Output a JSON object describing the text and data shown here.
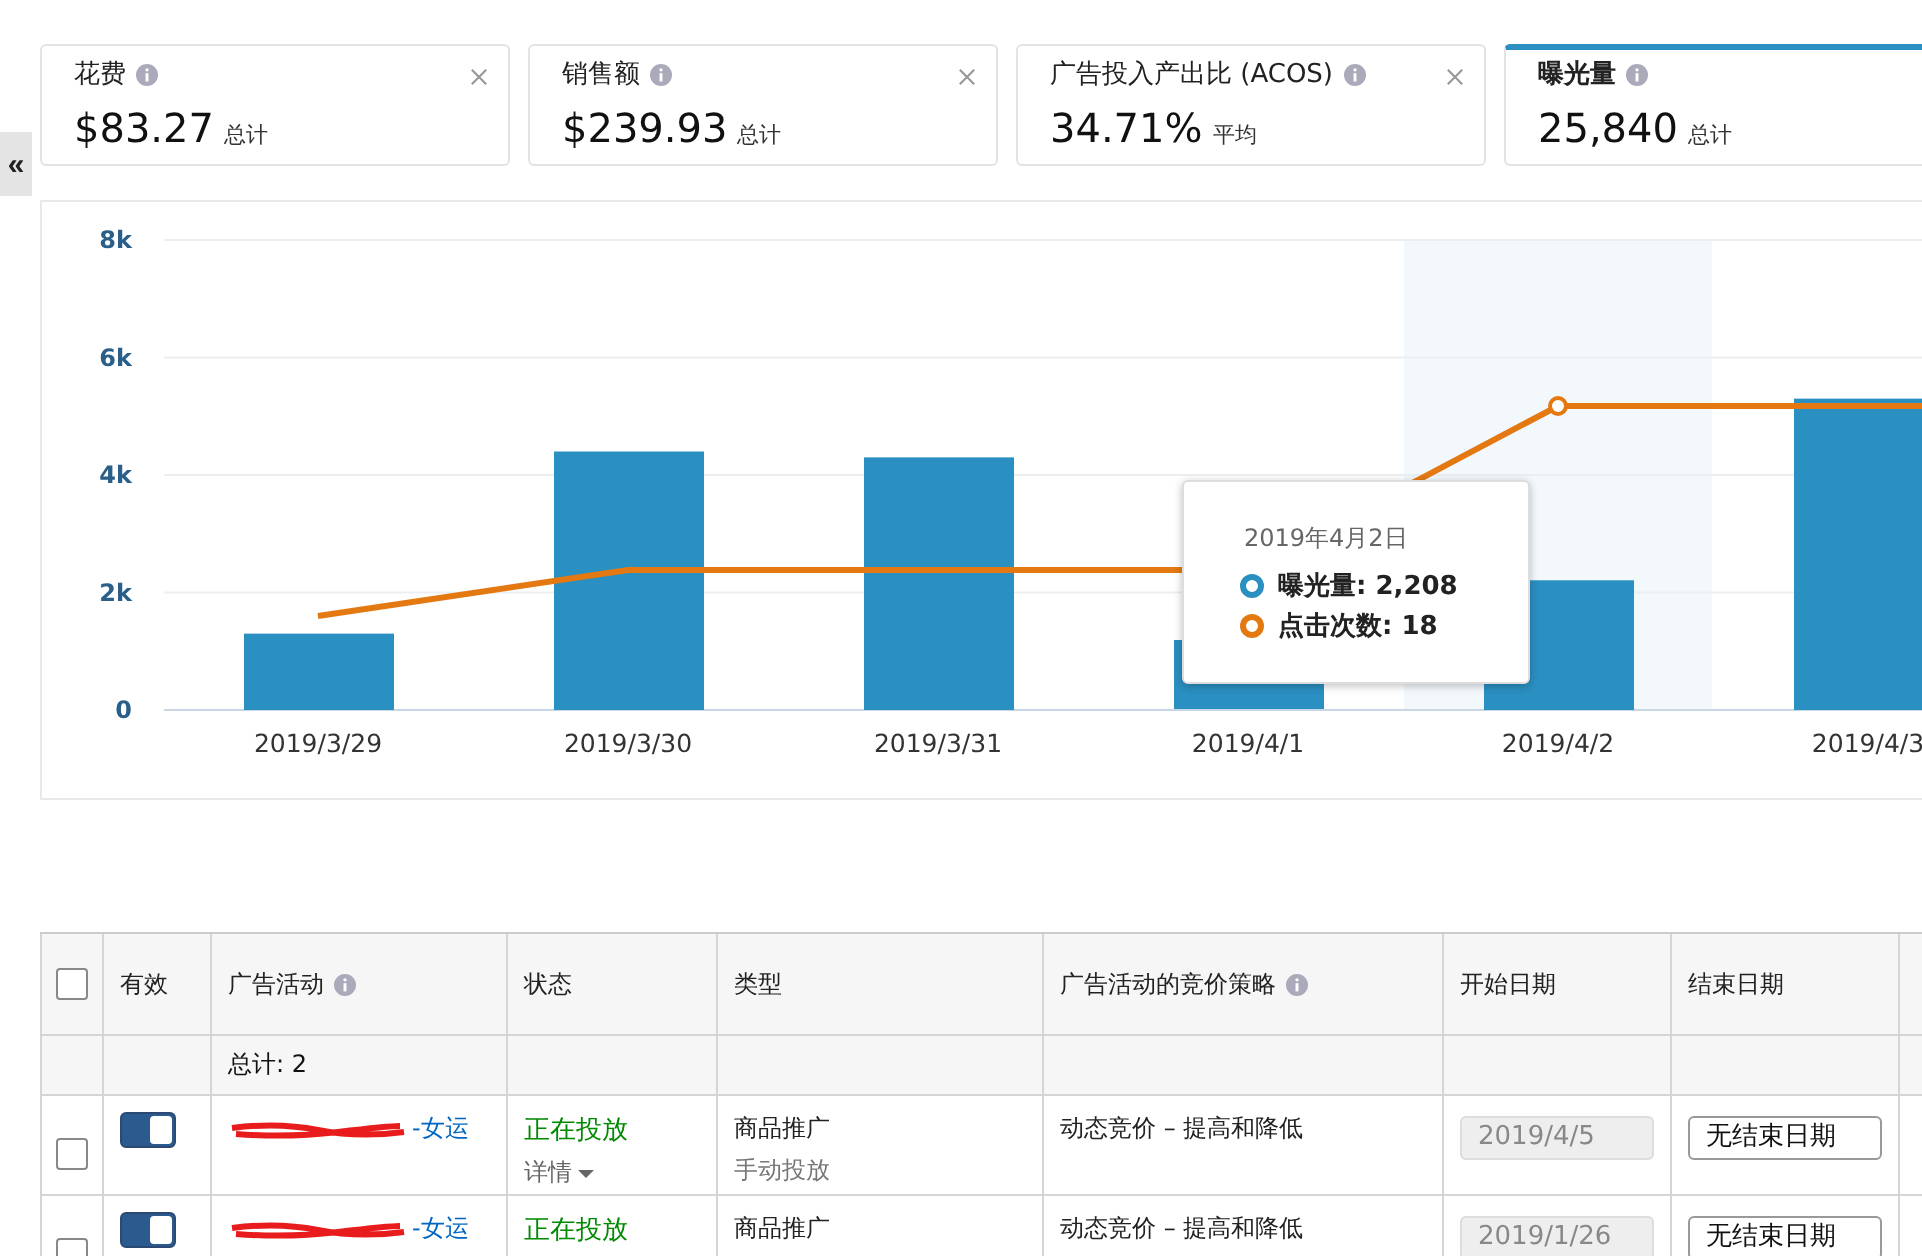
{
  "metric_cards": [
    {
      "label": "花费",
      "value": "$83.27",
      "unit": "总计",
      "selected": false,
      "closable": true
    },
    {
      "label": "销售额",
      "value": "$239.93",
      "unit": "总计",
      "selected": false,
      "closable": true
    },
    {
      "label": "广告投入产出比 (ACOS)",
      "value": "34.71%",
      "unit": "平均",
      "selected": false,
      "closable": true
    },
    {
      "label": "曝光量",
      "value": "25,840",
      "unit": "总计",
      "selected": true,
      "closable": false
    }
  ],
  "sidebar_toggle": "«",
  "chart": {
    "chart_data": {
      "type": "bar",
      "categories": [
        "2019/3/29",
        "2019/3/30",
        "2019/3/31",
        "2019/4/1",
        "2019/4/2",
        "2019/4/3"
      ],
      "values": [
        1300,
        4400,
        4300,
        null,
        2208,
        5300
      ],
      "ylim": [
        0,
        8000
      ],
      "grid": true,
      "yticks": [
        {
          "value": 0,
          "label": "0"
        },
        {
          "value": 2000,
          "label": "2k"
        },
        {
          "value": 4000,
          "label": "4k"
        },
        {
          "value": 6000,
          "label": "6k"
        },
        {
          "value": 8000,
          "label": "8k"
        }
      ]
    },
    "tooltip": {
      "date": "2019年4月2日",
      "lines": [
        {
          "label": "曝光量:",
          "value": "2,208",
          "color": "#2a8fc1"
        },
        {
          "label": "点击次数:",
          "value": "18",
          "color": "#e47911"
        }
      ]
    }
  },
  "table": {
    "select_all_checked": false,
    "columns": [
      "有效",
      "广告活动",
      "状态",
      "类型",
      "广告活动的竞价策略",
      "开始日期",
      "结束日期"
    ],
    "column_info": [
      false,
      true,
      false,
      false,
      true,
      false,
      false
    ],
    "total": "总计: 2",
    "rows": [
      {
        "checked": false,
        "enabled": true,
        "campaign": "-女运",
        "status": "正在投放",
        "details": "详情",
        "type": "商品推广",
        "targeting": "手动投放",
        "bidding": "动态竞价 – 提高和降低",
        "start_date": "2019/4/5",
        "end_date": "无结束日期"
      },
      {
        "checked": false,
        "enabled": true,
        "campaign": "-女运",
        "status": "正在投放",
        "details": "",
        "type": "商品推广",
        "targeting": "",
        "bidding": "动态竞价 – 提高和降低",
        "start_date": "2019/1/26",
        "end_date": "无结束日期"
      }
    ]
  }
}
